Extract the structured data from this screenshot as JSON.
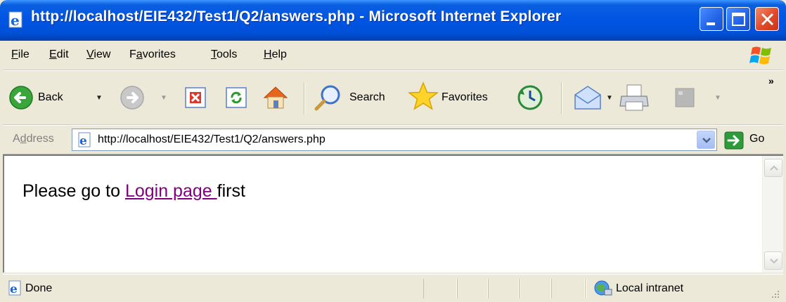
{
  "window": {
    "title": "http://localhost/EIE432/Test1/Q2/answers.php - Microsoft Internet Explorer"
  },
  "menu": {
    "items": [
      {
        "label": "File",
        "mnemonic": "F"
      },
      {
        "label": "Edit",
        "mnemonic": "E"
      },
      {
        "label": "View",
        "mnemonic": "V"
      },
      {
        "label": "Favorites",
        "mnemonic": "a"
      },
      {
        "label": "Tools",
        "mnemonic": "T"
      },
      {
        "label": "Help",
        "mnemonic": "H"
      }
    ]
  },
  "toolbar": {
    "back_label": "Back",
    "search_label": "Search",
    "favorites_label": "Favorites",
    "overflow": "»"
  },
  "address": {
    "label": "Address",
    "url": "http://localhost/EIE432/Test1/Q2/answers.php",
    "go_label": "Go"
  },
  "page": {
    "text_before": "Please go to ",
    "link_text": "Login page ",
    "text_after": "first"
  },
  "status": {
    "text": "Done",
    "zone": "Local intranet"
  },
  "colors": {
    "titlebar": "#0054e3",
    "link_visited": "#800080",
    "chrome": "#ece9d8"
  },
  "icons": [
    "ie-page-icon",
    "back-icon",
    "forward-icon",
    "stop-icon",
    "refresh-icon",
    "home-icon",
    "search-icon",
    "favorites-star-icon",
    "history-icon",
    "mail-icon",
    "print-icon",
    "edit-icon",
    "go-arrow-icon",
    "local-intranet-icon",
    "windows-flag-icon"
  ]
}
